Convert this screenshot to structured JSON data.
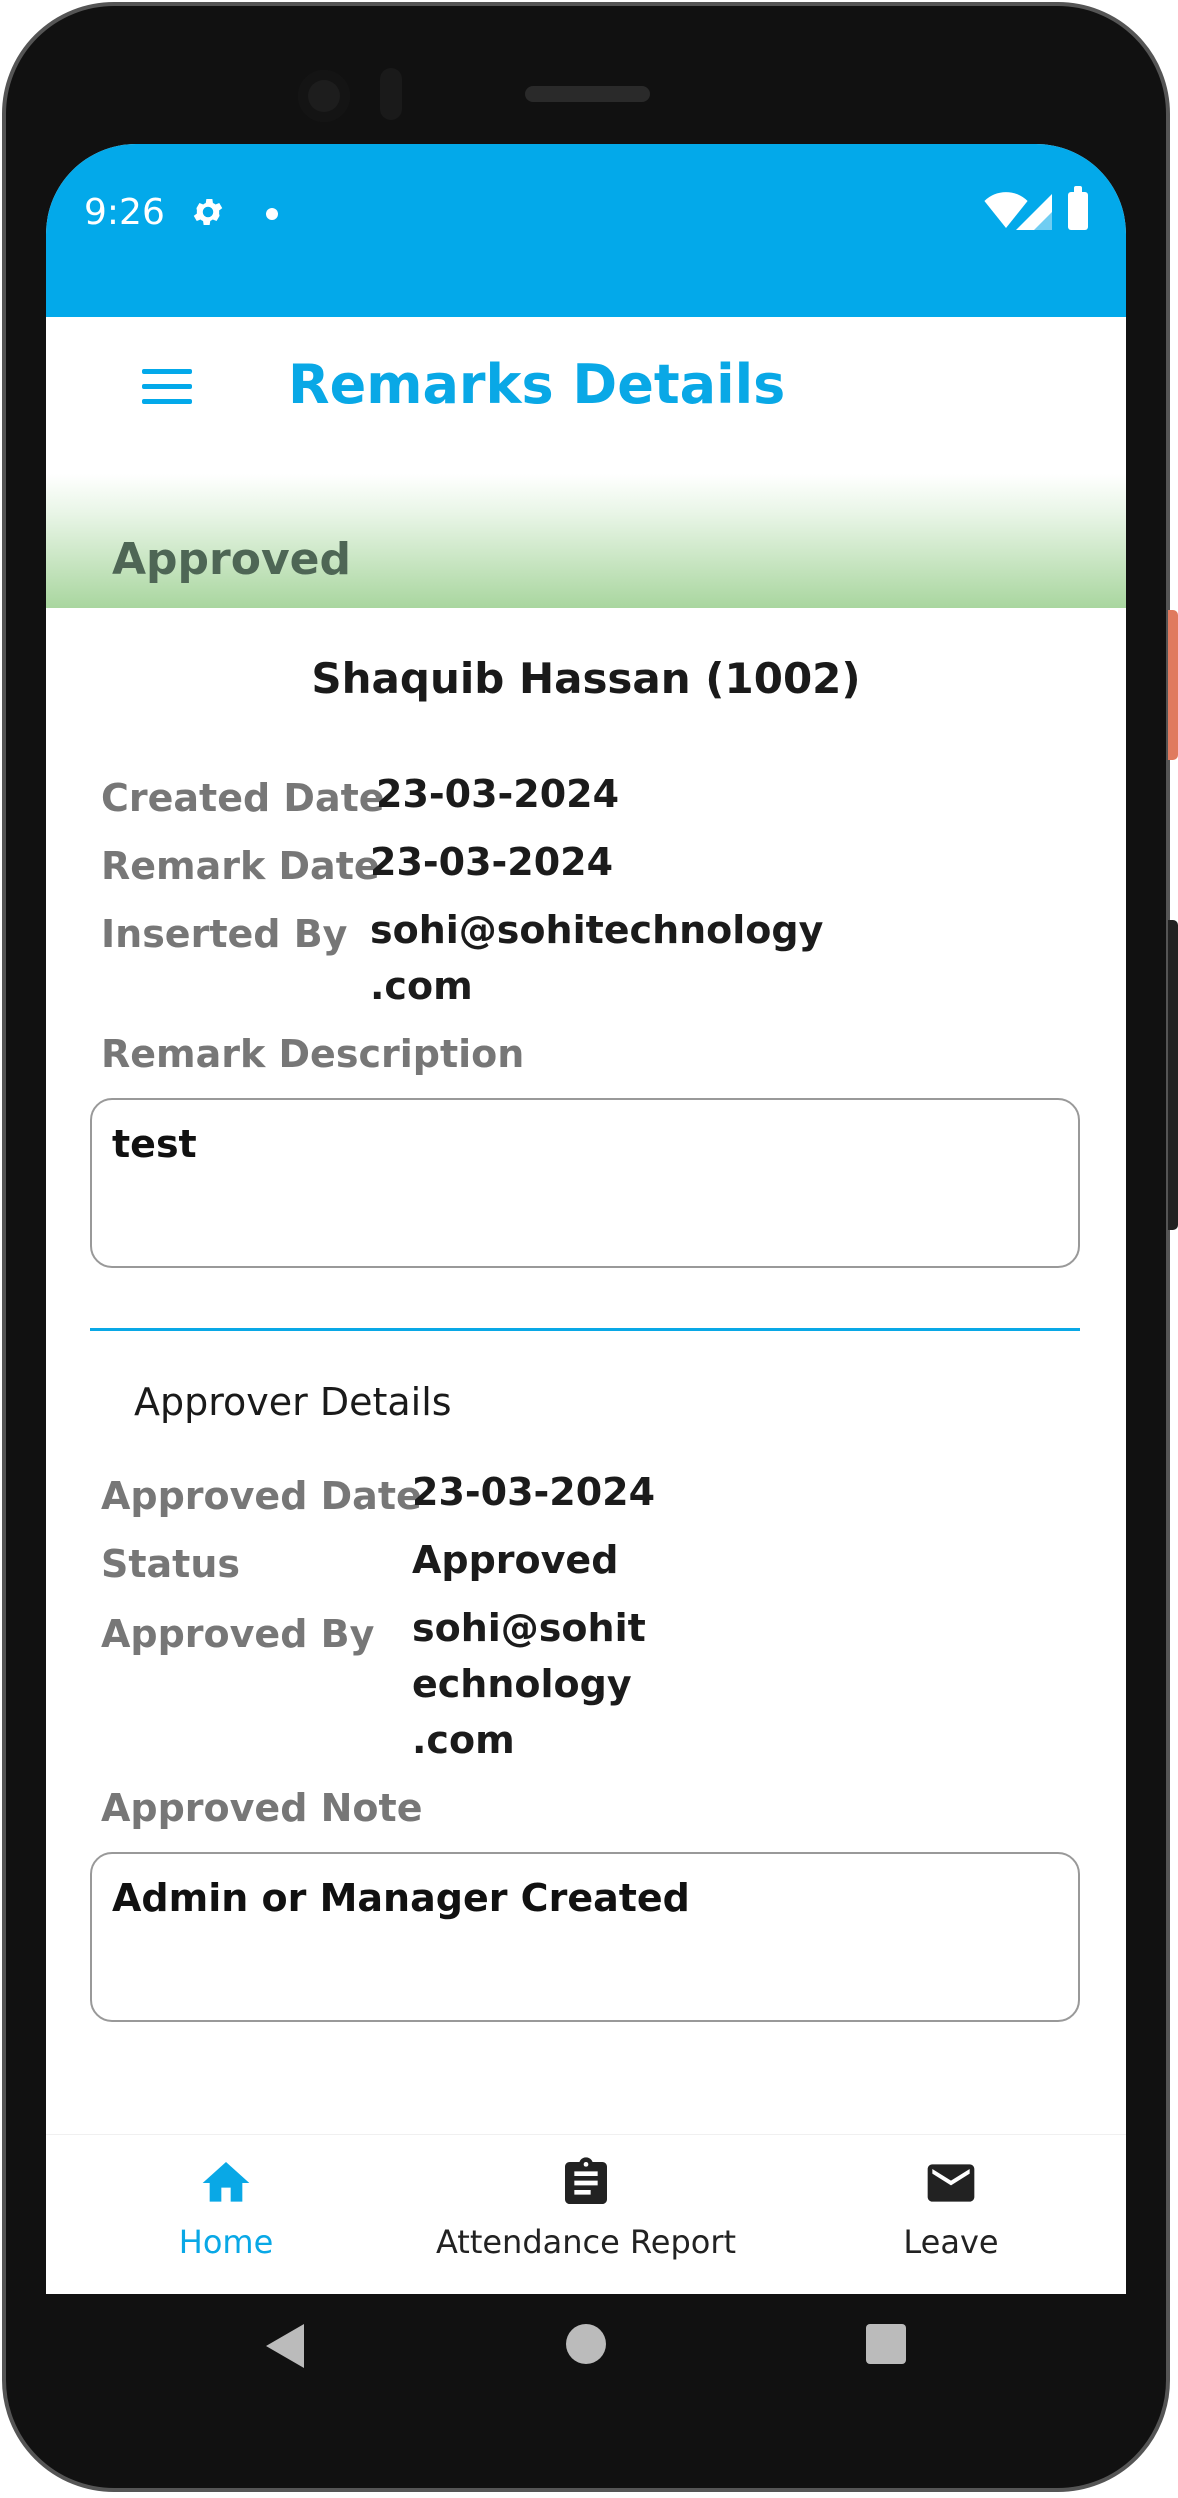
{
  "status_bar": {
    "time": "9:26"
  },
  "app_bar": {
    "title": "Remarks Details"
  },
  "banner": {
    "status": "Approved"
  },
  "employee": {
    "name": "Shaquib Hassan (1002)"
  },
  "remark": {
    "created_date_label": "Created Date",
    "created_date": "23-03-2024",
    "remark_date_label": "Remark Date",
    "remark_date": "23-03-2024",
    "inserted_by_label": "Inserted By",
    "inserted_by_line1": "sohi@sohitechnology",
    "inserted_by_line2": ".com",
    "description_label": "Remark Description",
    "description": "test"
  },
  "approver": {
    "section_title": "Approver Details",
    "approved_date_label": "Approved Date",
    "approved_date": "23-03-2024",
    "status_label": "Status",
    "status": "Approved",
    "approved_by_label": "Approved By",
    "approved_by_line1": "sohi@sohit",
    "approved_by_line2": "echnology",
    "approved_by_line3": ".com",
    "note_label": "Approved Note",
    "note": "Admin or Manager Created"
  },
  "bottom_nav": {
    "home": "Home",
    "attendance": "Attendance Report",
    "leave": "Leave"
  },
  "colors": {
    "primary": "#03a9ea",
    "banner_green": "#a9d69f"
  }
}
